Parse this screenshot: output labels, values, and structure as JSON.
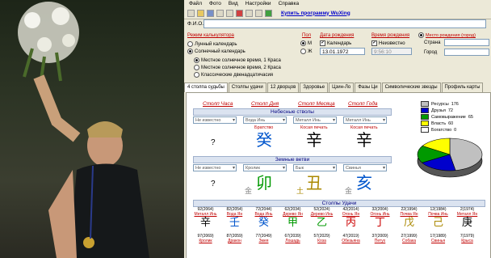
{
  "menu": [
    "Файл",
    "Фото",
    "Вид",
    "Настройки",
    "Справка"
  ],
  "toolbar_link": "Купить программу WuXing",
  "fio_label": "Ф.И.О.",
  "calc_mode": {
    "title": "Режим калькулятора",
    "options": [
      "Лунный календарь",
      "Солнечный календарь"
    ],
    "time_options": [
      "Местное солнечное время, 1 Краса",
      "Местное солнечное время, 2 Краса",
      "Классические двенадцатичасия"
    ]
  },
  "gender": {
    "title": "Пол",
    "male": "М",
    "female": "Ж"
  },
  "birth_date": {
    "title": "Дата рождения",
    "calendar_label": "Календарь",
    "value": "13.01.1972"
  },
  "birth_time": {
    "title": "Время рождения",
    "unknown_label": "Неизвестно",
    "value": "9:56:10"
  },
  "birth_place": {
    "title": "Место рождения (город)",
    "country_label": "Страна",
    "city_label": "Город"
  },
  "tabs": [
    "4 столпа судьбы",
    "Столпы удачи",
    "12 дворцов",
    "Здоровье",
    "Цзин-Ло",
    "Фазы Ци",
    "Символические звезды",
    "Профиль карты"
  ],
  "pillars": {
    "headers": [
      "Столп Часа",
      "Столп Дня",
      "Столп Месяца",
      "Столп Года"
    ],
    "stems_bar": "Небесные стволы",
    "branches_bar": "Земные ветви",
    "stems": [
      {
        "select": "Не известно",
        "label": "",
        "glyph": "?",
        "color": "#000000"
      },
      {
        "select": "Вода Инь",
        "label": "Братство",
        "glyph": "癸",
        "color": "#0055cc"
      },
      {
        "select": "Металл Инь",
        "label": "Косая печать",
        "glyph": "辛",
        "color": "#000000"
      },
      {
        "select": "Металл Инь",
        "label": "Косая печать",
        "glyph": "辛",
        "color": "#000000"
      }
    ],
    "branches": [
      {
        "select": "Не известно",
        "glyph": "?",
        "small": "",
        "color": "#000000"
      },
      {
        "select": "Кролик",
        "glyph": "卯",
        "small": "金",
        "color": "#009900"
      },
      {
        "select": "Бык",
        "glyph": "丑",
        "small": "土",
        "color": "#aa8800"
      },
      {
        "select": "Свинья",
        "glyph": "亥",
        "small": "金",
        "color": "#0055cc"
      }
    ]
  },
  "elements_legend": [
    {
      "label": "Ресурсы",
      "value": "176",
      "color": "#c0c0c0"
    },
    {
      "label": "Друзья",
      "value": "72",
      "color": "#0000cc"
    },
    {
      "label": "Самовыражение",
      "value": "65",
      "color": "#009900"
    },
    {
      "label": "Власть",
      "value": "60",
      "color": "#ffff00"
    },
    {
      "label": "Богатство",
      "value": "0",
      "color": "#ffffff"
    }
  ],
  "chart_data": {
    "type": "pie",
    "categories": [
      "Ресурсы",
      "Друзья",
      "Самовыражение",
      "Власть",
      "Богатство"
    ],
    "values": [
      176,
      72,
      65,
      60,
      0
    ]
  },
  "luck": {
    "bar": "Столпы Удачи",
    "top_years": [
      "92(2064)",
      "82(2054)",
      "72(2044)",
      "62(2034)",
      "52(2024)",
      "42(2014)",
      "32(2004)",
      "22(1994)",
      "12(1984)",
      "2(1974)"
    ],
    "top_labels": [
      "Металл Инь",
      "Вода Ян",
      "Вода Инь",
      "Дерево Ян",
      "Дерево Инь",
      "Огонь Ян",
      "Огонь Инь",
      "Почва Ян",
      "Почва Инь",
      "Металл Ян"
    ],
    "top_glyphs": [
      "辛",
      "壬",
      "癸",
      "甲",
      "乙",
      "丙",
      "丁",
      "戊",
      "己",
      "庚"
    ],
    "top_colors": [
      "#000000",
      "#0055cc",
      "#0055cc",
      "#009900",
      "#009900",
      "#cc0000",
      "#cc0000",
      "#aa8800",
      "#aa8800",
      "#000000"
    ],
    "bottom_years": [
      "97(2069)",
      "87(2059)",
      "77(2049)",
      "67(2039)",
      "57(2029)",
      "47(2019)",
      "37(2009)",
      "27(1999)",
      "17(1989)",
      "7(1979)"
    ],
    "bottom_glyphs": [
      "Кролик",
      "Дракон",
      "Змея",
      "Лошадь",
      "Коза",
      "Обезьяна",
      "Петух",
      "Собака",
      "Свинья",
      "Крыса"
    ]
  }
}
